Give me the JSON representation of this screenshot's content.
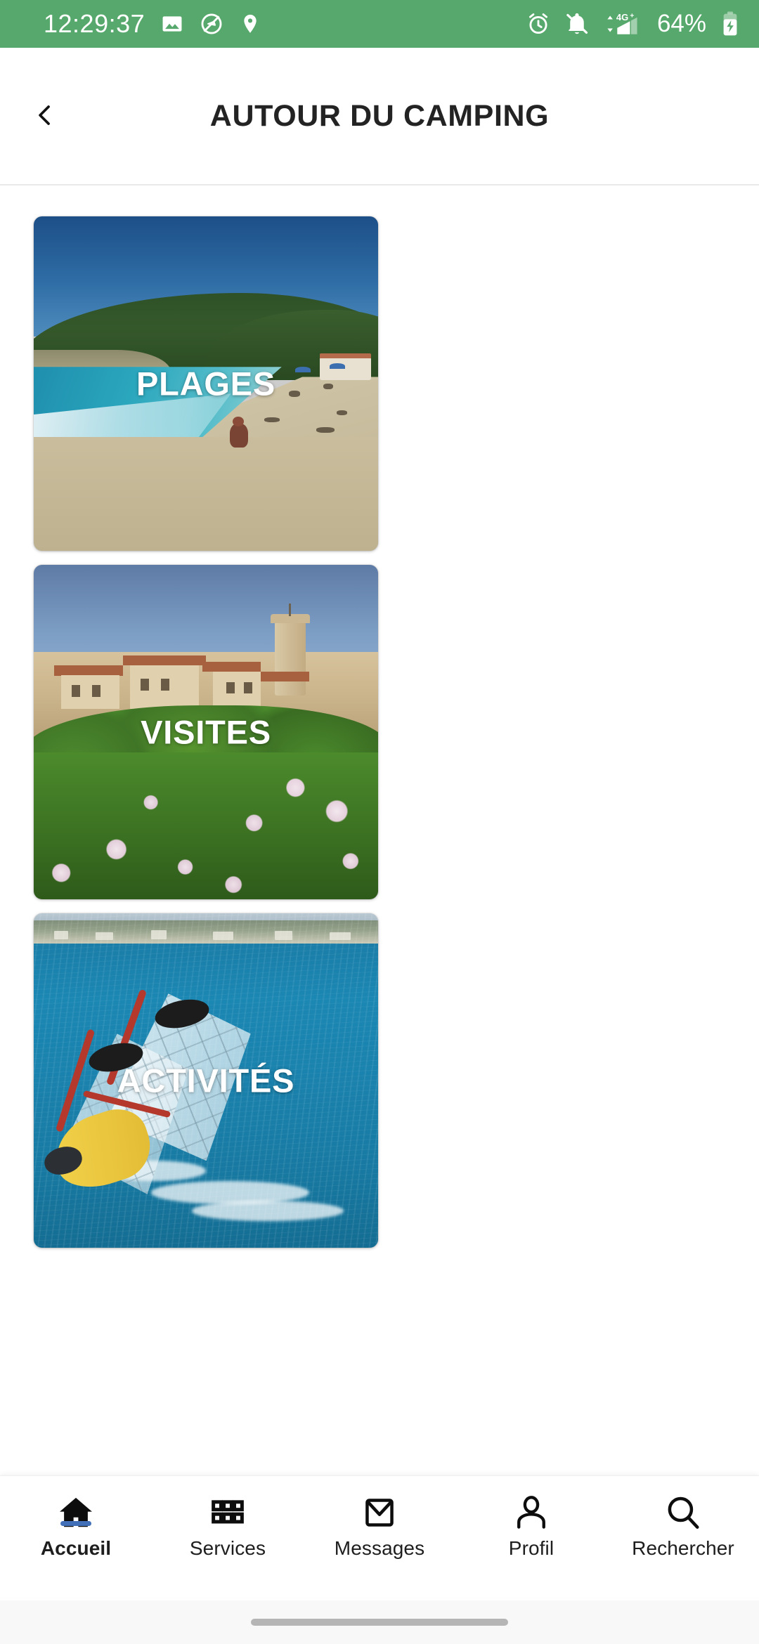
{
  "status_bar": {
    "time": "12:29:37",
    "battery_percent": "64%",
    "network_type": "4G+",
    "background_color": "#57a86c",
    "left_icons": [
      "photo-icon",
      "data-saver-icon",
      "location-pin-icon"
    ],
    "right_icons": [
      "alarm-clock-icon",
      "notifications-muted-icon",
      "signal-4g-plus-icon",
      "battery-charging-icon"
    ]
  },
  "header": {
    "title": "AUTOUR DU CAMPING",
    "back_icon": "chevron-left-icon"
  },
  "main": {
    "cards": [
      {
        "label": "PLAGES",
        "image": "beach-photo"
      },
      {
        "label": "VISITES",
        "image": "hilltop-village-photo"
      },
      {
        "label": "ACTIVITÉS",
        "image": "windsurfing-photo"
      }
    ]
  },
  "bottom_nav": {
    "active_index": 0,
    "active_color": "#4270b8",
    "items": [
      {
        "label": "Accueil",
        "icon": "home-icon"
      },
      {
        "label": "Services",
        "icon": "grid-apps-icon"
      },
      {
        "label": "Messages",
        "icon": "envelope-icon"
      },
      {
        "label": "Profil",
        "icon": "person-icon"
      },
      {
        "label": "Rechercher",
        "icon": "search-icon"
      }
    ]
  }
}
